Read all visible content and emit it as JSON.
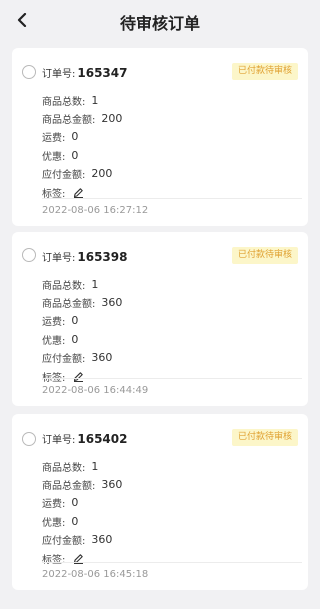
{
  "header": {
    "title": "待审核订单",
    "back_icon": "chevron-left-icon"
  },
  "labels": {
    "order_no": "订单号:",
    "total_qty": "商品总数:",
    "total_amount": "商品总金额:",
    "shipping": "运费:",
    "discount": "优惠:",
    "payable": "应付金额:",
    "tags": "标签:"
  },
  "orders": [
    {
      "order_no": "165347",
      "status": "已付款待审核",
      "total_qty": "1",
      "total_amount": "200",
      "shipping": "0",
      "discount": "0",
      "payable": "200",
      "time": "2022-08-06 16:27:12"
    },
    {
      "order_no": "165398",
      "status": "已付款待审核",
      "total_qty": "1",
      "total_amount": "360",
      "shipping": "0",
      "discount": "0",
      "payable": "360",
      "time": "2022-08-06 16:44:49"
    },
    {
      "order_no": "165402",
      "status": "已付款待审核",
      "total_qty": "1",
      "total_amount": "360",
      "shipping": "0",
      "discount": "0",
      "payable": "360",
      "time": "2022-08-06 16:45:18"
    }
  ],
  "colors": {
    "badge_bg": "#fcf6c9",
    "badge_text": "#e0a233",
    "page_bg": "#f1f1f3"
  }
}
